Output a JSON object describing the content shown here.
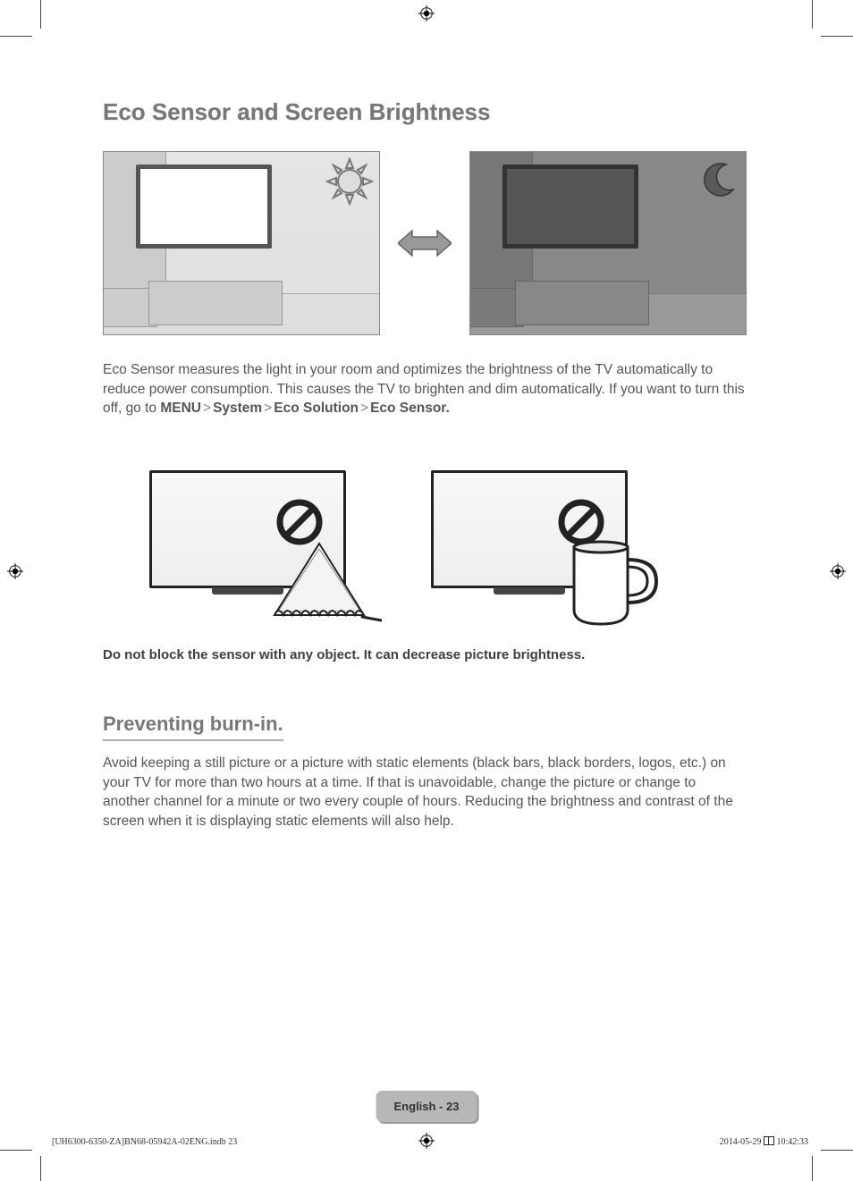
{
  "title": "Eco Sensor and Screen Brightness",
  "paragraph1": "Eco Sensor measures the light in your room and optimizes the brightness of the TV automatically to reduce power consumption. This causes the TV to brighten and dim automatically. If you want to turn this off, go to ",
  "menu": {
    "m1": "MENU",
    "m2": "System",
    "m3": "Eco Solution",
    "m4": "Eco Sensor"
  },
  "block_note": "Do not block the sensor with any object. It can decrease picture brightness.",
  "subtitle": "Preventing burn-in.",
  "paragraph2": "Avoid keeping a still picture or a picture with static elements (black bars, black borders, logos, etc.) on your TV for more than two hours at a time. If that is unavoidable, change the picture or change to another channel for a minute or two every couple of hours. Reducing the brightness and contrast of the screen when it is displaying static elements will also help.",
  "page_badge": "English - 23",
  "footer_left": "[UH6300-6350-ZA]BN68-05942A-02ENG.indb   23",
  "footer_right_date": "2014-05-29   ",
  "footer_right_time": "10:42:33"
}
